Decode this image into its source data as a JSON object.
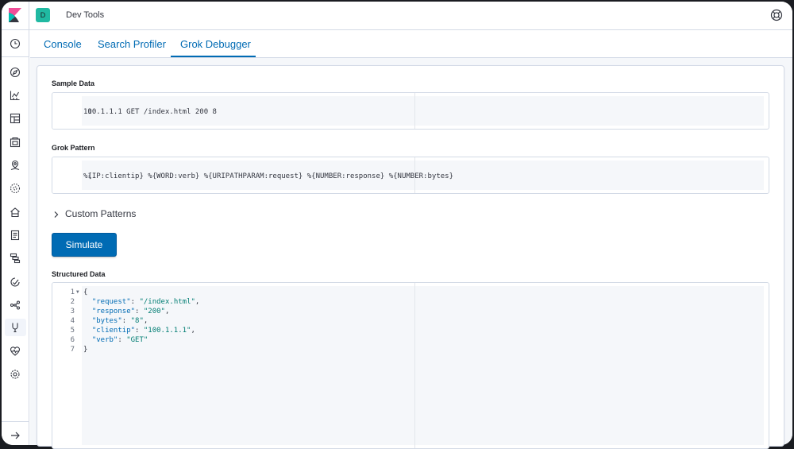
{
  "header": {
    "space_initial": "D",
    "app_title": "Dev Tools"
  },
  "sidebar": {
    "items": [
      {
        "icon": "clock-icon",
        "label": "Recently viewed"
      },
      {
        "icon": "compass-icon",
        "label": "Discover"
      },
      {
        "icon": "visualize-icon",
        "label": "Visualize"
      },
      {
        "icon": "dashboard-icon",
        "label": "Dashboard"
      },
      {
        "icon": "canvas-icon",
        "label": "Canvas"
      },
      {
        "icon": "maps-icon",
        "label": "Maps"
      },
      {
        "icon": "ml-icon",
        "label": "Machine Learning"
      },
      {
        "icon": "infrastructure-icon",
        "label": "Infrastructure"
      },
      {
        "icon": "logs-icon",
        "label": "Logs"
      },
      {
        "icon": "apm-icon",
        "label": "APM"
      },
      {
        "icon": "uptime-icon",
        "label": "Uptime"
      },
      {
        "icon": "graph-icon",
        "label": "Graph"
      },
      {
        "icon": "devtools-icon",
        "label": "Dev Tools",
        "active": true
      },
      {
        "icon": "monitoring-icon",
        "label": "Stack Monitoring"
      },
      {
        "icon": "management-icon",
        "label": "Management"
      },
      {
        "icon": "arrow-right-icon",
        "label": "Expand"
      }
    ]
  },
  "tabs": [
    {
      "label": "Console"
    },
    {
      "label": "Search Profiler"
    },
    {
      "label": "Grok Debugger",
      "selected": true
    }
  ],
  "sample_data": {
    "label": "Sample Data",
    "lines": [
      "100.1.1.1 GET /index.html 200 8"
    ]
  },
  "grok_pattern": {
    "label": "Grok Pattern",
    "lines": [
      "%{IP:clientip} %{WORD:verb} %{URIPATHPARAM:request} %{NUMBER:response} %{NUMBER:bytes}"
    ]
  },
  "custom_patterns": {
    "label": "Custom Patterns"
  },
  "simulate_button": {
    "label": "Simulate"
  },
  "structured_data": {
    "label": "Structured Data",
    "lines": [
      "{",
      "  \"request\": \"/index.html\",",
      "  \"response\": \"200\",",
      "  \"bytes\": \"8\",",
      "  \"clientip\": \"100.1.1.1\",",
      "  \"verb\": \"GET\"",
      "}"
    ]
  },
  "colors": {
    "accent": "#006bb4",
    "space_badge": "#20b9a2",
    "string_value": "#017d73"
  }
}
